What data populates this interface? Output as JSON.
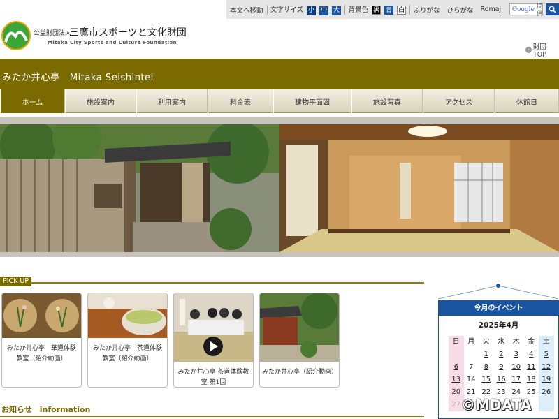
{
  "utility": {
    "skip_link": "本文へ移動",
    "font_size_label": "文字サイズ",
    "font_sizes": [
      "小",
      "中",
      "大"
    ],
    "bg_color_label": "背景色",
    "bg_colors": [
      "黒",
      "青",
      "白"
    ],
    "furigana": "ふりがな",
    "hiragana": "ひらがな",
    "romaji": "Romaji",
    "search_brand": "Google",
    "search_placeholder": "提供"
  },
  "org": {
    "kind": "公益財団法人",
    "name": "三鷹市スポーツと文化財団",
    "name_en": "Mitaka City Sports and Culture Foundation",
    "top_link": "財団TOP"
  },
  "site_title": "みたか井心亭　Mitaka Seishintei",
  "nav": [
    "ホーム",
    "施設案内",
    "利用案内",
    "料金表",
    "建物平面図",
    "施設写真",
    "アクセス",
    "休館日"
  ],
  "pickup": {
    "heading": "PICK UP",
    "cards": [
      {
        "caption": "みたか井心亭　華道体験教室（紹介動画）"
      },
      {
        "caption": "みたか井心亭　茶道体験教室（紹介動画）"
      },
      {
        "caption": "みたか井心亭 茶道体験教室 第1回"
      },
      {
        "caption": "みたか井心亭（紹介動画）"
      }
    ]
  },
  "info": {
    "heading": "お知らせ　information"
  },
  "events": {
    "title": "今月のイベント",
    "month": "2025年4月",
    "weekdays": [
      "日",
      "月",
      "火",
      "水",
      "木",
      "金",
      "土"
    ],
    "weeks": [
      [
        "",
        "",
        "1",
        "2",
        "3",
        "4",
        "5"
      ],
      [
        "6",
        "7",
        "8",
        "9",
        "10",
        "11",
        "12"
      ],
      [
        "13",
        "14",
        "15",
        "16",
        "17",
        "18",
        "19"
      ],
      [
        "20",
        "21",
        "22",
        "23",
        "24",
        "25",
        "26"
      ],
      [
        "27",
        "",
        "",
        "",
        "",
        "",
        ""
      ]
    ]
  },
  "watermark": "©MDATA",
  "colors": {
    "brand_olive": "#7b6a00",
    "brand_blue": "#1a53a0"
  }
}
